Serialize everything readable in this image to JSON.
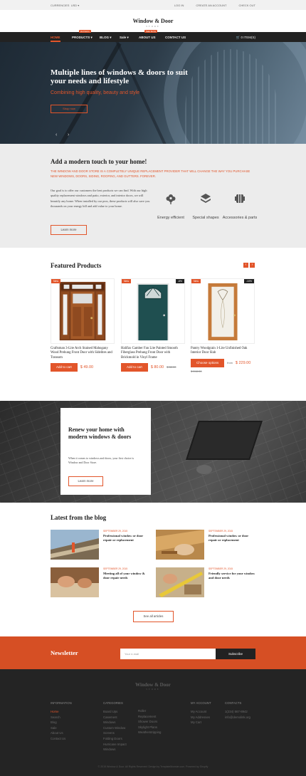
{
  "topbar": {
    "currency_label": "CURRENCIES",
    "currency_value": "USD",
    "links": [
      "LOG IN",
      "CREATE AN ACCOUNT",
      "CHECK OUT"
    ]
  },
  "header": {
    "logo": "Window & Door",
    "logo_sub": "STORE"
  },
  "nav": {
    "items": [
      "HOME",
      "PRODUCTS",
      "BLOG",
      "Sale",
      "ABOUT US",
      "CONTACT US"
    ],
    "tags": [
      "Hot items",
      "Sale items"
    ],
    "cart": "0 ITEM(S)"
  },
  "hero": {
    "title": "Multiple lines of windows & doors to suit your needs and lifestyle",
    "subtitle": "Combining high quality, beauty and style",
    "button": "Shop now"
  },
  "about": {
    "title": "Add a modern touch to your home!",
    "lead": "THE WINDOW AND DOOR STORE IS A COMPLETELY UNIQUE REPLACEMENT PROVIDER THAT WILL CHANGE THE WAY YOU PURCHASE NEW WINDOWS, DOORS, SIDING, ROOFING, AND GUTTERS. FOREVER.",
    "body": "Our goal is to offer our customers the best products we can find. With our high quality replacement windows and patio, exterior, and interior doors, we will beautify any home. When installed by our pros, these products will also save you thousands on your energy bill and add value to your home.",
    "button": "Learn more",
    "features": [
      {
        "label": "Energy efficient",
        "icon": "flower-icon"
      },
      {
        "label": "Special shapes",
        "icon": "layers-icon"
      },
      {
        "label": "Accessories & parts",
        "icon": "accessories-icon"
      }
    ]
  },
  "featured": {
    "title": "Featured Products",
    "products": [
      {
        "badge": "New",
        "discount": "",
        "name": "Craftsman 3-Lite Arch Stained Mahogany Wood Prehung Front Door with Sidelites and Transom",
        "button": "Add to cart",
        "price": "$ 49.00",
        "old_price": "",
        "from": ""
      },
      {
        "badge": "New",
        "discount": "-8%",
        "name": "Halifax Camber Fan Lite Painted Smooth Fiberglass Prehung Front Door with Brickmold in Vinyl Frame",
        "button": "Add to cart",
        "price": "$ 80.00",
        "old_price": "$ 88.00",
        "from": ""
      },
      {
        "badge": "New",
        "discount": "-10%",
        "name": "Pantry Woodgrain 1-Lite Unfinished Oak Interior Door Slab",
        "button": "Choose options",
        "price": "$ 229.00",
        "old_price": "$ 248.00",
        "from": "from"
      }
    ]
  },
  "renew": {
    "title": "Renew your home with modern windows & doors",
    "body": "When it comes to windows and doors, your first choice is Window and Door Store.",
    "button": "Learn more"
  },
  "blog": {
    "title": "Latest from the blog",
    "posts": [
      {
        "date": "SEPTEMBER 29, 2015",
        "title": "Professional window or door repair or replacement"
      },
      {
        "date": "SEPTEMBER 29, 2015",
        "title": "Professional window or door repair or replacement"
      },
      {
        "date": "SEPTEMBER 29, 2015",
        "title": "Meeting all of your window & door repair needs"
      },
      {
        "date": "SEPTEMBER 29, 2015",
        "title": "Friendly service for your window and door needs"
      }
    ],
    "all_button": "See all articles"
  },
  "newsletter": {
    "title": "Newsletter",
    "placeholder": "Your e-mail",
    "button": "Subscribe"
  },
  "footer": {
    "logo": "Window & Door",
    "logo_sub": "STORE",
    "information": {
      "heading": "INFORMATION",
      "links": [
        "Home",
        "Search",
        "Blog",
        "Sale",
        "About Us",
        "Contact Us"
      ]
    },
    "categories": {
      "heading": "CATEGORIES",
      "col1": [
        "Board Ups",
        "Casement",
        "Windows",
        "Custom Window",
        "Screens",
        "Folding Doors",
        "Hurricane Impact",
        "Windows"
      ],
      "col2": [
        "Roller",
        "Replacement",
        "Shower Doors",
        "Skylight Plans",
        "Weatherstripping"
      ]
    },
    "account": {
      "heading": "MY ACCOUNT",
      "links": [
        "My Account",
        "My Addresses",
        "My Cart"
      ]
    },
    "contacts": {
      "heading": "CONTACTS",
      "links": [
        "1(234) 567-8942",
        "info@demolink.org"
      ]
    },
    "copyright": "© 2015 Window & Door. All Rights Reserved. Design by TemplateMonster.com. Powered by Shopify"
  },
  "colors": {
    "accent": "#e2552a",
    "dark": "#222222",
    "footer": "#242424"
  }
}
